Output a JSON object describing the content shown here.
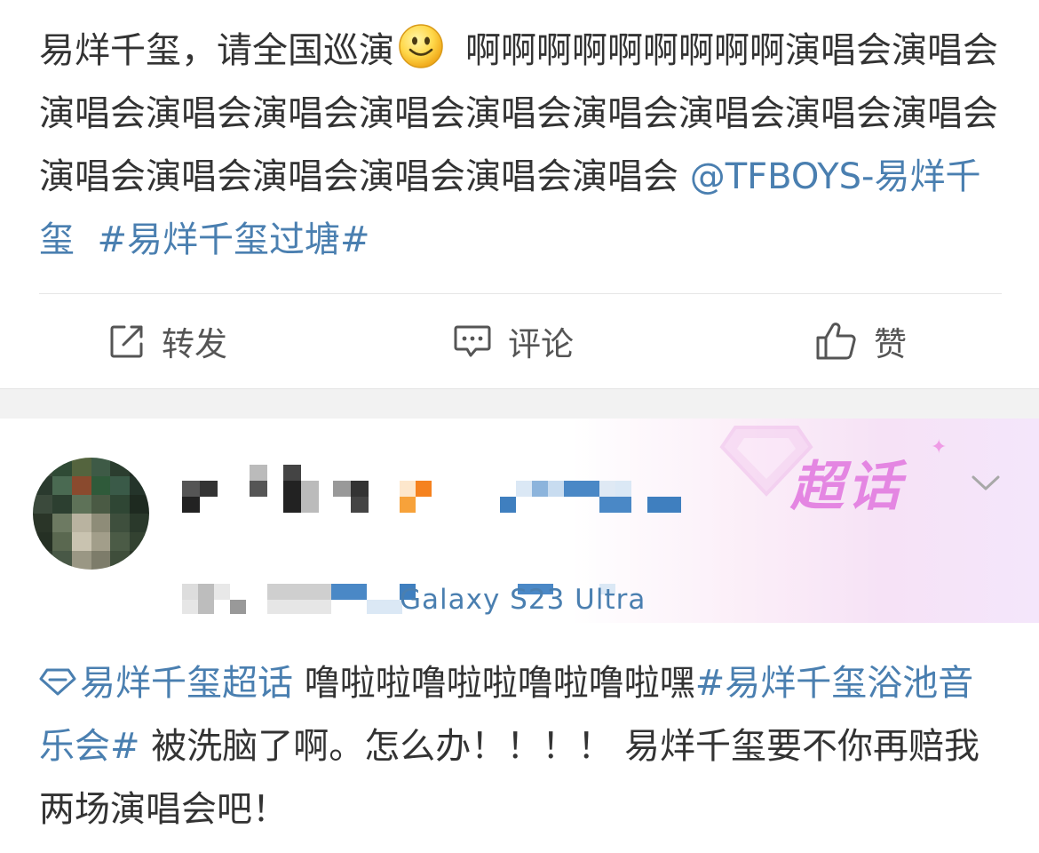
{
  "post1": {
    "text_before_emoji": "易烊千玺，请全国巡演",
    "emoji": "smiley",
    "text_after_emoji": "啊啊啊啊啊啊啊啊啊演唱会演唱会演唱会演唱会演唱会演唱会演唱会演唱会演唱会演唱会演唱会演唱会演唱会演唱会演唱会演唱会演唱会",
    "mention": "@TFBOYS-易烊千玺",
    "hashtag": "#易烊千玺过塘#"
  },
  "actions": {
    "repost": "转发",
    "comment": "评论",
    "like": "赞"
  },
  "post2": {
    "badge": "超话",
    "device_suffix": "Galaxy S23 Ultra",
    "supertopic": "易烊千玺超话",
    "text1": "噜啦啦噜啦啦噜啦噜啦嘿",
    "hashtag": "#易烊千玺浴池音乐会#",
    "text2": "被洗脑了啊。怎么办！！！！ 易烊千玺要不你再赔我两场演唱会吧！"
  },
  "colors": {
    "link": "#4a7fb0",
    "text": "#333333",
    "badge": "#e486e2",
    "icon": "#555555"
  }
}
